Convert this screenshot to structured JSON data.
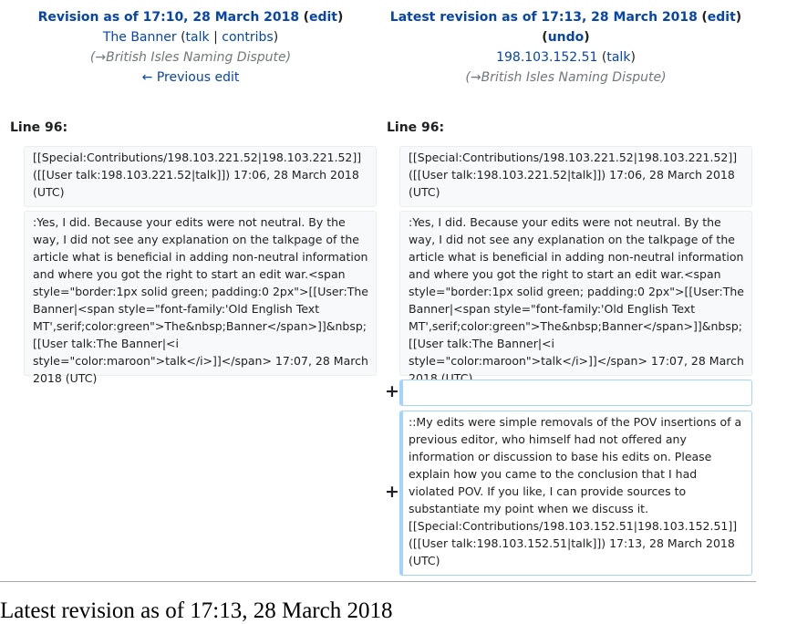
{
  "left_header": {
    "title": "Revision as of 17:10, 28 March 2018",
    "edit_label": "edit",
    "user": "The Banner",
    "talk_label": "talk",
    "sep": "|",
    "contribs_label": "contribs",
    "summary_arrow": "→",
    "summary": "British Isles Naming Dispute",
    "prev_label": "← Previous edit"
  },
  "right_header": {
    "title": "Latest revision as of 17:13, 28 March 2018",
    "edit_label": "edit",
    "undo_label": "undo",
    "user": "198.103.152.51",
    "talk_label": "talk",
    "summary_arrow": "→",
    "summary": "British Isles Naming Dispute"
  },
  "diff": {
    "left_line": "Line 96:",
    "right_line": "Line 96:",
    "context1": "[[Special:Contributions/198.103.221.52|198.103.221.52]] ([[User talk:198.103.221.52|talk]]) 17:06, 28 March 2018 (UTC)",
    "context2": ":Yes, I did. Because your edits were not neutral. By the way, I did not see any explanation on the talkpage of the article what is beneficial in adding non-neutral information and where you got the right to start an edit war.<span style=\"border:1px solid green; padding:0 2px\">[[User:The Banner|<span style=\"font-family:'Old English Text MT',serif;color:green\">The&nbsp;Banner</span>]]&nbsp;[[User talk:The Banner|<i style=\"color:maroon\">talk</i>]]</span> 17:07, 28 March 2018 (UTC)",
    "added_empty": "",
    "added_text": "::My edits were simple removals of the POV insertions of a previous editor, who himself had not offered any information or discussion to base his edits on. Please explain how you came to the conclusion that I had violated POV. If you like, I can provide sources to substantiate my point when we discuss it. [[Special:Contributions/198.103.152.51|198.103.152.51]] ([[User talk:198.103.152.51|talk]]) 17:13, 28 March 2018 (UTC)",
    "plus": "+"
  },
  "footer": {
    "title": "Latest revision as of 17:13, 28 March 2018"
  },
  "colors": {
    "link": "#0645ad",
    "context_bg": "#f8f9fa",
    "added_border": "#a3d3ff",
    "summary": "#72777d"
  }
}
